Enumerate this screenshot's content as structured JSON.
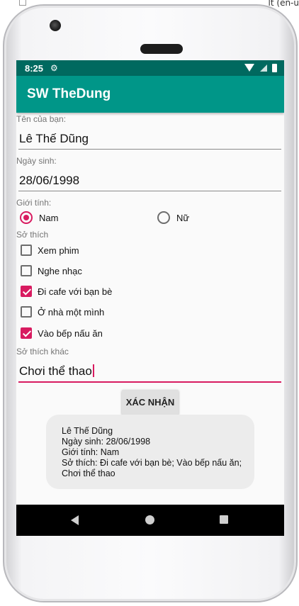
{
  "host": {
    "fragment": "lt (en-u"
  },
  "status": {
    "time": "8:25",
    "gear_icon": "gear-icon",
    "wifi_icon": "wifi-icon",
    "signal_icon": "signal-icon",
    "battery_icon": "battery-icon"
  },
  "app": {
    "title": "SW TheDung",
    "accent": "#009688",
    "status_color": "#00695f",
    "highlight": "#d81b60"
  },
  "form": {
    "name_label": "Tên của bạn:",
    "name_value": "Lê Thế Dũng",
    "dob_label": "Ngày sinh:",
    "dob_value": "28/06/1998",
    "gender_label": "Giới tính:",
    "gender_options": [
      {
        "label": "Nam",
        "selected": true
      },
      {
        "label": "Nữ",
        "selected": false
      }
    ],
    "hobby_label": "Sở thích",
    "hobbies": [
      {
        "label": "Xem phim",
        "checked": false
      },
      {
        "label": "Nghe nhạc",
        "checked": false
      },
      {
        "label": "Đi cafe với bạn bè",
        "checked": true
      },
      {
        "label": "Ở nhà một mình",
        "checked": false
      },
      {
        "label": "Vào bếp nấu ăn",
        "checked": true
      }
    ],
    "other_label": "Sở thích khác",
    "other_value": "Chơi thể thao",
    "submit_label": "XÁC NHẬN"
  },
  "result": {
    "line1": "Lê Thế Dũng",
    "line2": "Ngày sinh: 28/06/1998",
    "line3": "Giới tính: Nam",
    "line4": "Sở thích: Đi cafe với bạn bè; Vào bếp nấu ăn; Chơi thể thao"
  },
  "nav": {
    "back_icon": "back-icon",
    "home_icon": "home-icon",
    "recents_icon": "recents-icon"
  }
}
